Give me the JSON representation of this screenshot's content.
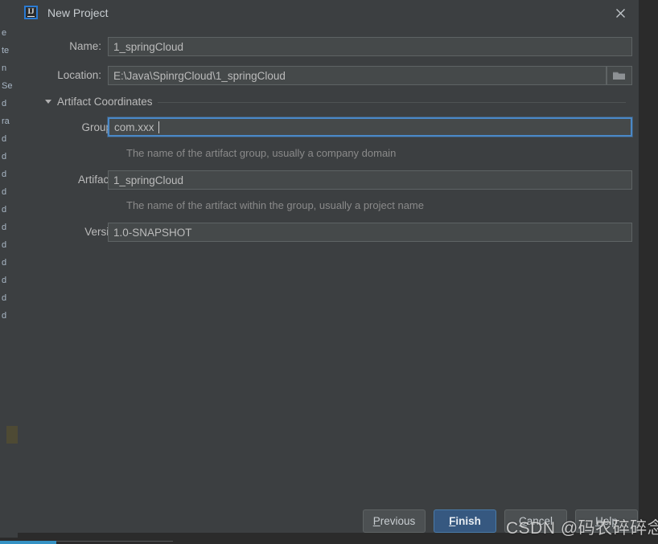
{
  "window": {
    "title": "New Project",
    "app_icon": "intellij-idea-icon",
    "icon_text": "IJ",
    "close_icon": "close-icon"
  },
  "form": {
    "fields": [
      {
        "id": "name",
        "label": "Name:",
        "value": "1_springCloud",
        "placeholder": "",
        "focused": false
      },
      {
        "id": "location",
        "label": "Location:",
        "value": "E:\\Java\\SpinrgCloud\\1_springCloud",
        "placeholder": "",
        "focused": false,
        "browse_icon": "folder-icon"
      }
    ]
  },
  "artifact_section": {
    "title": "Artifact Coordinates",
    "expanded": true,
    "collapse_icon": "chevron-down-icon",
    "fields": [
      {
        "id": "groupid",
        "label": "GroupId:",
        "value": "com.xxx",
        "placeholder": "",
        "focused": true,
        "hint": "The name of the artifact group, usually a company domain"
      },
      {
        "id": "artifactid",
        "label": "ArtifactId:",
        "value": "1_springCloud",
        "placeholder": "",
        "focused": false,
        "hint": "The name of the artifact within the group, usually a project name"
      },
      {
        "id": "version",
        "label": "Version:",
        "value": "1.0-SNAPSHOT",
        "placeholder": "",
        "focused": false,
        "hint": ""
      }
    ]
  },
  "footer": {
    "buttons": [
      {
        "id": "previous",
        "label": "Previous",
        "mnemonic": "P",
        "primary": false
      },
      {
        "id": "finish",
        "label": "Finish",
        "mnemonic": "F",
        "primary": true
      },
      {
        "id": "cancel",
        "label": "Cancel",
        "mnemonic": "C",
        "primary": false
      },
      {
        "id": "help",
        "label": "Help",
        "mnemonic": "H",
        "primary": false
      }
    ]
  },
  "watermark": {
    "text": "CSDN @码农碎碎念"
  },
  "background": {
    "fragments": [
      "e",
      "te",
      "n",
      "Se",
      "d",
      "ra",
      "d",
      "d",
      "d",
      "d",
      "d",
      "d",
      "d",
      "d",
      "d",
      "d",
      "d"
    ]
  },
  "colors": {
    "dialog_bg": "#3c3f41",
    "ide_bg": "#2b2b2b",
    "input_bg": "#45494a",
    "accent_blue": "#365880",
    "focus_blue": "#4a88c7",
    "text": "#bbbbbb",
    "hint_text": "#8a8a8a"
  }
}
